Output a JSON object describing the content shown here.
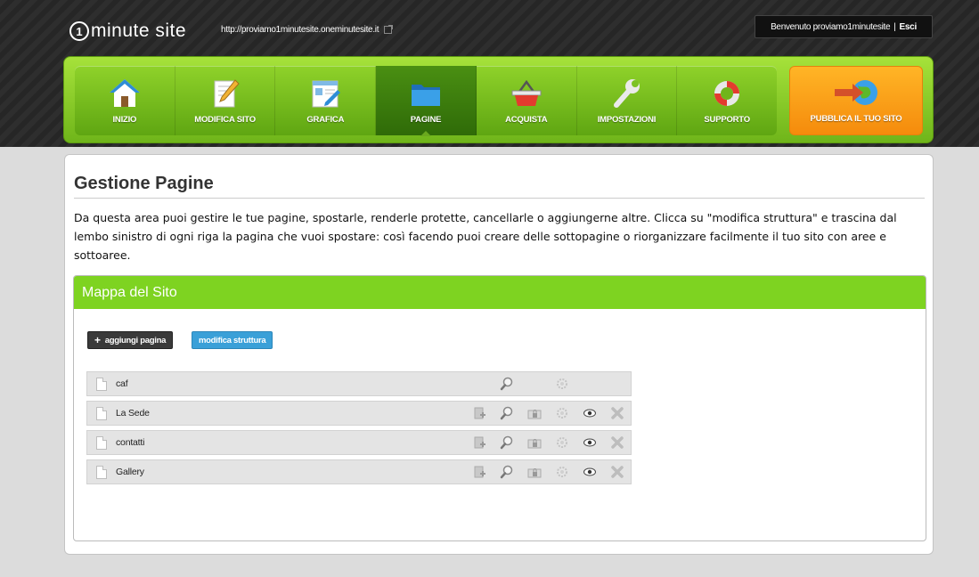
{
  "header": {
    "logo_digit": "1",
    "logo_text": "minute site",
    "site_url": "http://proviamo1minutesite.oneminutesite.it",
    "welcome_text": "Benvenuto proviamo1minutesite",
    "separator": "|",
    "logout_label": "Esci"
  },
  "nav": {
    "items": [
      {
        "label": "INIZIO",
        "icon": "home-icon"
      },
      {
        "label": "MODIFICA SITO",
        "icon": "edit-icon"
      },
      {
        "label": "GRAFICA",
        "icon": "graphics-icon"
      },
      {
        "label": "PAGINE",
        "icon": "folder-icon"
      },
      {
        "label": "ACQUISTA",
        "icon": "basket-icon"
      },
      {
        "label": "IMPOSTAZIONI",
        "icon": "wrench-icon"
      },
      {
        "label": "SUPPORTO",
        "icon": "lifebuoy-icon"
      }
    ],
    "active": "PAGINE",
    "publish_label": "PUBBLICA IL TUO SITO"
  },
  "main": {
    "title": "Gestione Pagine",
    "intro": "Da questa area puoi gestire le tue pagine, spostarle, renderle protette, cancellarle o aggiungerne altre. Clicca su \"modifica struttura\" e trascina dal lembo sinistro di ogni riga la pagina che vuoi spostare: così facendo puoi creare delle sottopagine o riorganizzare facilmente il tuo sito con aree e sottoaree.",
    "map_title": "Mappa del Sito",
    "add_page_label": "aggiungi pagina",
    "edit_structure_label": "modifica struttura",
    "pages": [
      {
        "name": "caf",
        "actions": [
          "search",
          "settings"
        ]
      },
      {
        "name": "La Sede",
        "actions": [
          "add",
          "search",
          "protect",
          "settings",
          "view",
          "delete"
        ]
      },
      {
        "name": "contatti",
        "actions": [
          "add",
          "search",
          "protect",
          "settings",
          "view",
          "delete"
        ]
      },
      {
        "name": "Gallery",
        "actions": [
          "add",
          "search",
          "protect",
          "settings",
          "view",
          "delete"
        ]
      }
    ]
  },
  "colors": {
    "nav_green": "#7ed321",
    "publish_orange": "#f7941d",
    "button_blue": "#3aa0d8"
  }
}
